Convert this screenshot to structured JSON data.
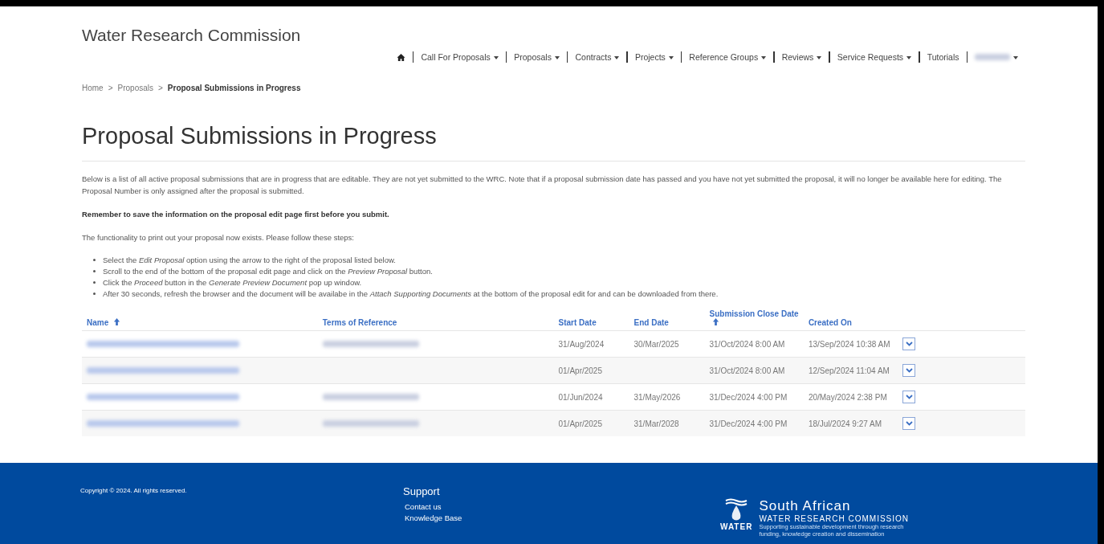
{
  "header": {
    "site_title": "Water Research Commission"
  },
  "nav": {
    "items": [
      {
        "label": "Call For Proposals",
        "dropdown": true
      },
      {
        "label": "Proposals",
        "dropdown": true
      },
      {
        "label": "Contracts",
        "dropdown": true
      },
      {
        "label": "Projects",
        "dropdown": true
      },
      {
        "label": "Reference Groups",
        "dropdown": true
      },
      {
        "label": "Reviews",
        "dropdown": true
      },
      {
        "label": "Service Requests",
        "dropdown": true
      },
      {
        "label": "Tutorials",
        "dropdown": false
      }
    ],
    "user_redacted": true
  },
  "breadcrumb_separator": ">",
  "breadcrumb": [
    {
      "label": "Home",
      "current": false
    },
    {
      "label": "Proposals",
      "current": false
    },
    {
      "label": "Proposal Submissions in Progress",
      "current": true
    }
  ],
  "page_title": "Proposal Submissions in Progress",
  "intro": "Below is a list of all active proposal submissions that are in progress that are editable. They are not yet submitted to the WRC. Note that if a proposal submission date has passed and you have not yet submitted the proposal, it will no longer be available here for editing. The Proposal Number is only assigned after the proposal is submitted.",
  "reminder": "Remember to save the information on the proposal edit page first before you submit.",
  "steps_intro": "The functionality to print out your proposal now exists. Please follow these steps:",
  "steps": [
    "Select the *Edit Proposal* option using the arrow to the right of the proposal listed below.",
    "Scroll to the end of the bottom of the proposal edit page and click on the *Preview Proposal* button.",
    "Click the *Proceed* button in the *Generate Preview Document* pop up window.",
    "After 30 seconds, refresh the browser and the document will be availabe in the *Attach Supporting Documents* at the bottom of the proposal edit for and can be downloaded from there."
  ],
  "table": {
    "columns": [
      {
        "label": "Name",
        "sorted": true
      },
      {
        "label": "Terms of Reference",
        "sorted": false
      },
      {
        "label": "Start Date",
        "sorted": false
      },
      {
        "label": "End Date",
        "sorted": false
      },
      {
        "label": "Submission Close Date",
        "sorted": true
      },
      {
        "label": "Created On",
        "sorted": false
      }
    ],
    "rows": [
      {
        "terms_shown": true,
        "start": "31/Aug/2024",
        "end": "30/Mar/2025",
        "close": "31/Oct/2024 8:00 AM",
        "created": "13/Sep/2024 10:38 AM"
      },
      {
        "terms_shown": false,
        "start": "01/Apr/2025",
        "end": "",
        "close": "31/Oct/2024 8:00 AM",
        "created": "12/Sep/2024 11:04 AM"
      },
      {
        "terms_shown": true,
        "start": "01/Jun/2024",
        "end": "31/May/2026",
        "close": "31/Dec/2024 4:00 PM",
        "created": "20/May/2024 2:38 PM"
      },
      {
        "terms_shown": true,
        "start": "01/Apr/2025",
        "end": "31/Mar/2028",
        "close": "31/Dec/2024 4:00 PM",
        "created": "18/Jul/2024 9:27 AM"
      }
    ]
  },
  "footer": {
    "copyright": "Copyright © 2024. All rights reserved.",
    "support_heading": "Support",
    "links": [
      "Contact us",
      "Knowledge Base"
    ],
    "logo": {
      "word": "WATER",
      "line1": "South African",
      "line2": "WATER RESEARCH COMMISSION",
      "line3": "Supporting sustainable development through research",
      "line4": "funding, knowledge creation and dissemination"
    }
  }
}
